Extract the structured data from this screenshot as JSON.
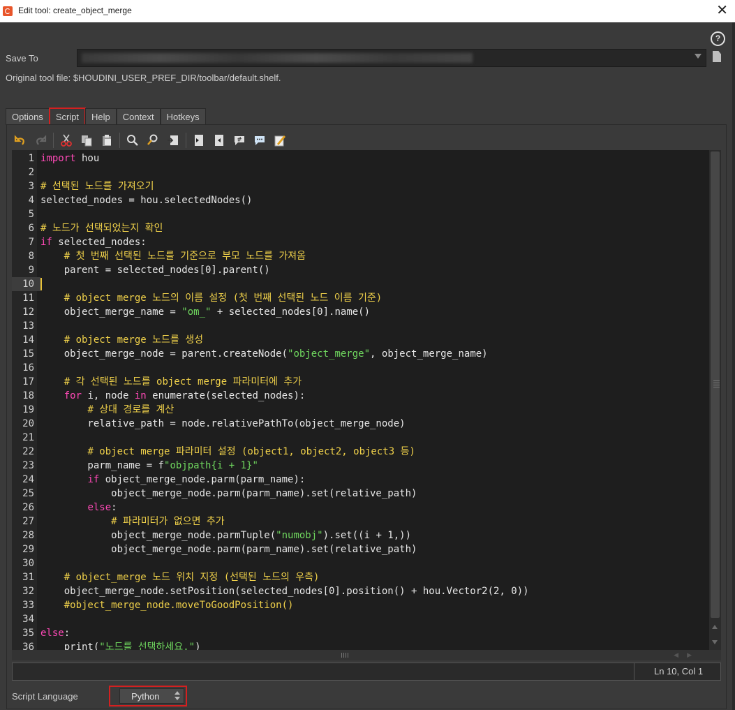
{
  "window": {
    "title": "Edit tool: create_object_merge",
    "close_icon": "close-icon",
    "help_glyph": "?"
  },
  "save_to": {
    "label": "Save To",
    "value_obscured": true
  },
  "original_tool_file": "Original tool file: $HOUDINI_USER_PREF_DIR/toolbar/default.shelf.",
  "tabs": [
    {
      "label": "Options",
      "active": false
    },
    {
      "label": "Script",
      "active": true
    },
    {
      "label": "Help",
      "active": false
    },
    {
      "label": "Context",
      "active": false
    },
    {
      "label": "Hotkeys",
      "active": false
    }
  ],
  "toolbar_icons": [
    "undo-icon",
    "redo-icon",
    "cut-icon",
    "copy-icon",
    "paste-icon",
    "find-icon",
    "find-replace-icon",
    "goto-line-icon",
    "indent-icon",
    "unindent-icon",
    "comment-icon",
    "uncomment-icon",
    "edit-external-icon"
  ],
  "editor": {
    "current_line": 10,
    "lines": [
      {
        "n": "1",
        "t": "import hou"
      },
      {
        "n": "2",
        "t": ""
      },
      {
        "n": "3",
        "t": "# 선택된 노드를 가져오기"
      },
      {
        "n": "4",
        "t": "selected_nodes = hou.selectedNodes()"
      },
      {
        "n": "5",
        "t": ""
      },
      {
        "n": "6",
        "t": "# 노드가 선택되었는지 확인"
      },
      {
        "n": "7",
        "t": "if selected_nodes:"
      },
      {
        "n": "8",
        "t": "    # 첫 번째 선택된 노드를 기준으로 부모 노드를 가져옴"
      },
      {
        "n": "9",
        "t": "    parent = selected_nodes[0].parent()"
      },
      {
        "n": "10",
        "t": ""
      },
      {
        "n": "11",
        "t": "    # object merge 노드의 이름 설정 (첫 번째 선택된 노드 이름 기준)"
      },
      {
        "n": "12",
        "t": "    object_merge_name = \"om_\" + selected_nodes[0].name()"
      },
      {
        "n": "13",
        "t": ""
      },
      {
        "n": "14",
        "t": "    # object merge 노드를 생성"
      },
      {
        "n": "15",
        "t": "    object_merge_node = parent.createNode(\"object_merge\", object_merge_name)"
      },
      {
        "n": "16",
        "t": ""
      },
      {
        "n": "17",
        "t": "    # 각 선택된 노드를 object merge 파라미터에 추가"
      },
      {
        "n": "18",
        "t": "    for i, node in enumerate(selected_nodes):"
      },
      {
        "n": "19",
        "t": "        # 상대 경로를 계산"
      },
      {
        "n": "20",
        "t": "        relative_path = node.relativePathTo(object_merge_node)"
      },
      {
        "n": "21",
        "t": ""
      },
      {
        "n": "22",
        "t": "        # object merge 파라미터 설정 (object1, object2, object3 등)"
      },
      {
        "n": "23",
        "t": "        parm_name = f\"objpath{i + 1}\""
      },
      {
        "n": "24",
        "t": "        if object_merge_node.parm(parm_name):"
      },
      {
        "n": "25",
        "t": "            object_merge_node.parm(parm_name).set(relative_path)"
      },
      {
        "n": "26",
        "t": "        else:"
      },
      {
        "n": "27",
        "t": "            # 파라미터가 없으면 추가"
      },
      {
        "n": "28",
        "t": "            object_merge_node.parmTuple(\"numobj\").set((i + 1,))"
      },
      {
        "n": "29",
        "t": "            object_merge_node.parm(parm_name).set(relative_path)"
      },
      {
        "n": "30",
        "t": ""
      },
      {
        "n": "31",
        "t": "    # object_merge 노드 위치 지정 (선택된 노드의 우측)"
      },
      {
        "n": "32",
        "t": "    object_merge_node.setPosition(selected_nodes[0].position() + hou.Vector2(2, 0))"
      },
      {
        "n": "33",
        "t": "    #object_merge_node.moveToGoodPosition()"
      },
      {
        "n": "34",
        "t": ""
      },
      {
        "n": "35",
        "t": "else:"
      },
      {
        "n": "36",
        "t": "    print(\"노드를 선택하세요.\")"
      }
    ]
  },
  "status": {
    "position": "Ln 10, Col 1"
  },
  "script_language": {
    "label": "Script Language",
    "value": "Python"
  },
  "colors": {
    "keyword": "#ff49b7",
    "comment": "#f0d14a",
    "string": "#6fd65e",
    "highlight_outline": "#d42020"
  }
}
